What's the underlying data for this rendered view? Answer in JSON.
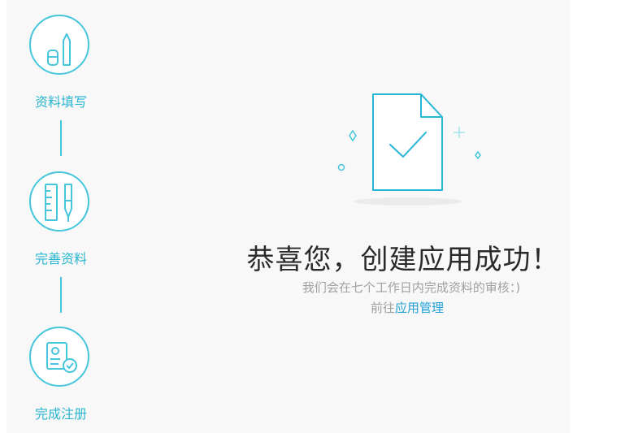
{
  "steps": [
    {
      "label": "资料填写",
      "icon": "pencil-eraser-icon"
    },
    {
      "label": "完善资料",
      "icon": "ruler-pen-icon"
    },
    {
      "label": "完成注册",
      "icon": "id-card-check-icon"
    }
  ],
  "result": {
    "title": "恭喜您，创建应用成功！",
    "message": "我们会在七个工作日内完成资料的审核：)",
    "goto_prefix": "前往",
    "goto_link": "应用管理"
  },
  "colors": {
    "accent": "#45c6dc",
    "link": "#1e9fd6",
    "panel_bg": "#f8f8f8"
  }
}
